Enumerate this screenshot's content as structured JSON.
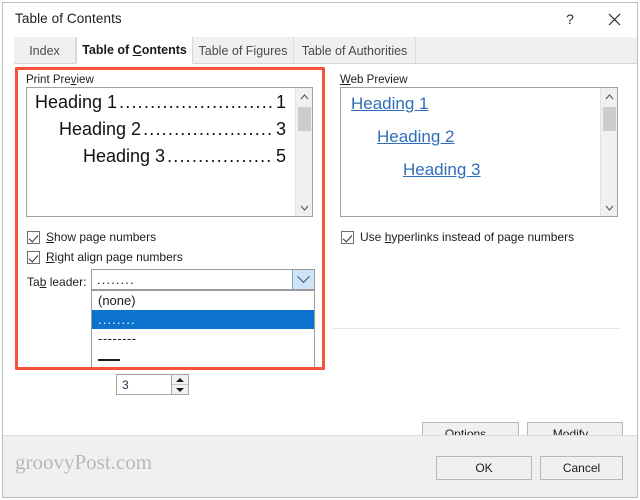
{
  "window": {
    "title": "Table of Contents",
    "help_icon": "?",
    "close_icon": "close-icon"
  },
  "tabs": [
    {
      "label": "Index",
      "accel": "",
      "active": false
    },
    {
      "label": "Table of ",
      "accel": "C",
      "label_rest": "ontents",
      "active": true
    },
    {
      "label": "Table of Figures",
      "accel": "",
      "active": false
    },
    {
      "label": "Table of Authorities",
      "accel": "",
      "active": false
    }
  ],
  "print_preview": {
    "legend_before": "Print Pre",
    "legend_accel": "v",
    "legend_after": "iew",
    "lines": [
      {
        "text": "Heading 1",
        "leader": "..............................",
        "page": "1",
        "indent": 1
      },
      {
        "text": "Heading 2",
        "leader": "...........................",
        "page": "3",
        "indent": 2
      },
      {
        "text": "Heading 3",
        "leader": "........................",
        "page": "5",
        "indent": 3
      }
    ],
    "scroll_up": "⌃",
    "scroll_down": "⌄"
  },
  "web_preview": {
    "legend_accel": "W",
    "legend_after": "eb Preview",
    "lines": [
      {
        "text": "Heading 1",
        "indent": 1
      },
      {
        "text": "Heading 2",
        "indent": 2
      },
      {
        "text": "Heading 3",
        "indent": 3
      }
    ],
    "scroll_up": "⌃",
    "scroll_down": "⌄"
  },
  "options": {
    "show_page_numbers": {
      "accel": "S",
      "label_after": "how page numbers",
      "checked": true
    },
    "right_align": {
      "accel": "R",
      "label_after": "ight align page numbers",
      "checked": true
    },
    "use_hyperlinks": {
      "label_before": "Use ",
      "accel": "h",
      "label_after": "yperlinks instead of page numbers",
      "checked": true
    },
    "tab_leader": {
      "label_before": "Ta",
      "accel": "b",
      "label_after": " leader:",
      "value": "........",
      "expanded": true,
      "items": [
        {
          "kind": "text",
          "label": "(none)",
          "selected": false
        },
        {
          "kind": "dots",
          "label": "........",
          "selected": true
        },
        {
          "kind": "dash",
          "label": "--------",
          "selected": false
        },
        {
          "kind": "solid",
          "label": "——",
          "selected": false
        }
      ]
    },
    "show_levels": {
      "value": "3"
    }
  },
  "buttons": {
    "options": {
      "accel": "O",
      "label_after": "ptions..."
    },
    "modify": {
      "accel": "M",
      "label_after": "odify..."
    },
    "ok": "OK",
    "cancel": "Cancel"
  },
  "watermark": "groovyPost.com",
  "colors": {
    "accent_selection": "#0c72cd",
    "hyperlink": "#2f6fba",
    "annotation": "#f4543c",
    "dialog_bg": "#ffffff",
    "footer_bg": "#f0f0f0"
  }
}
